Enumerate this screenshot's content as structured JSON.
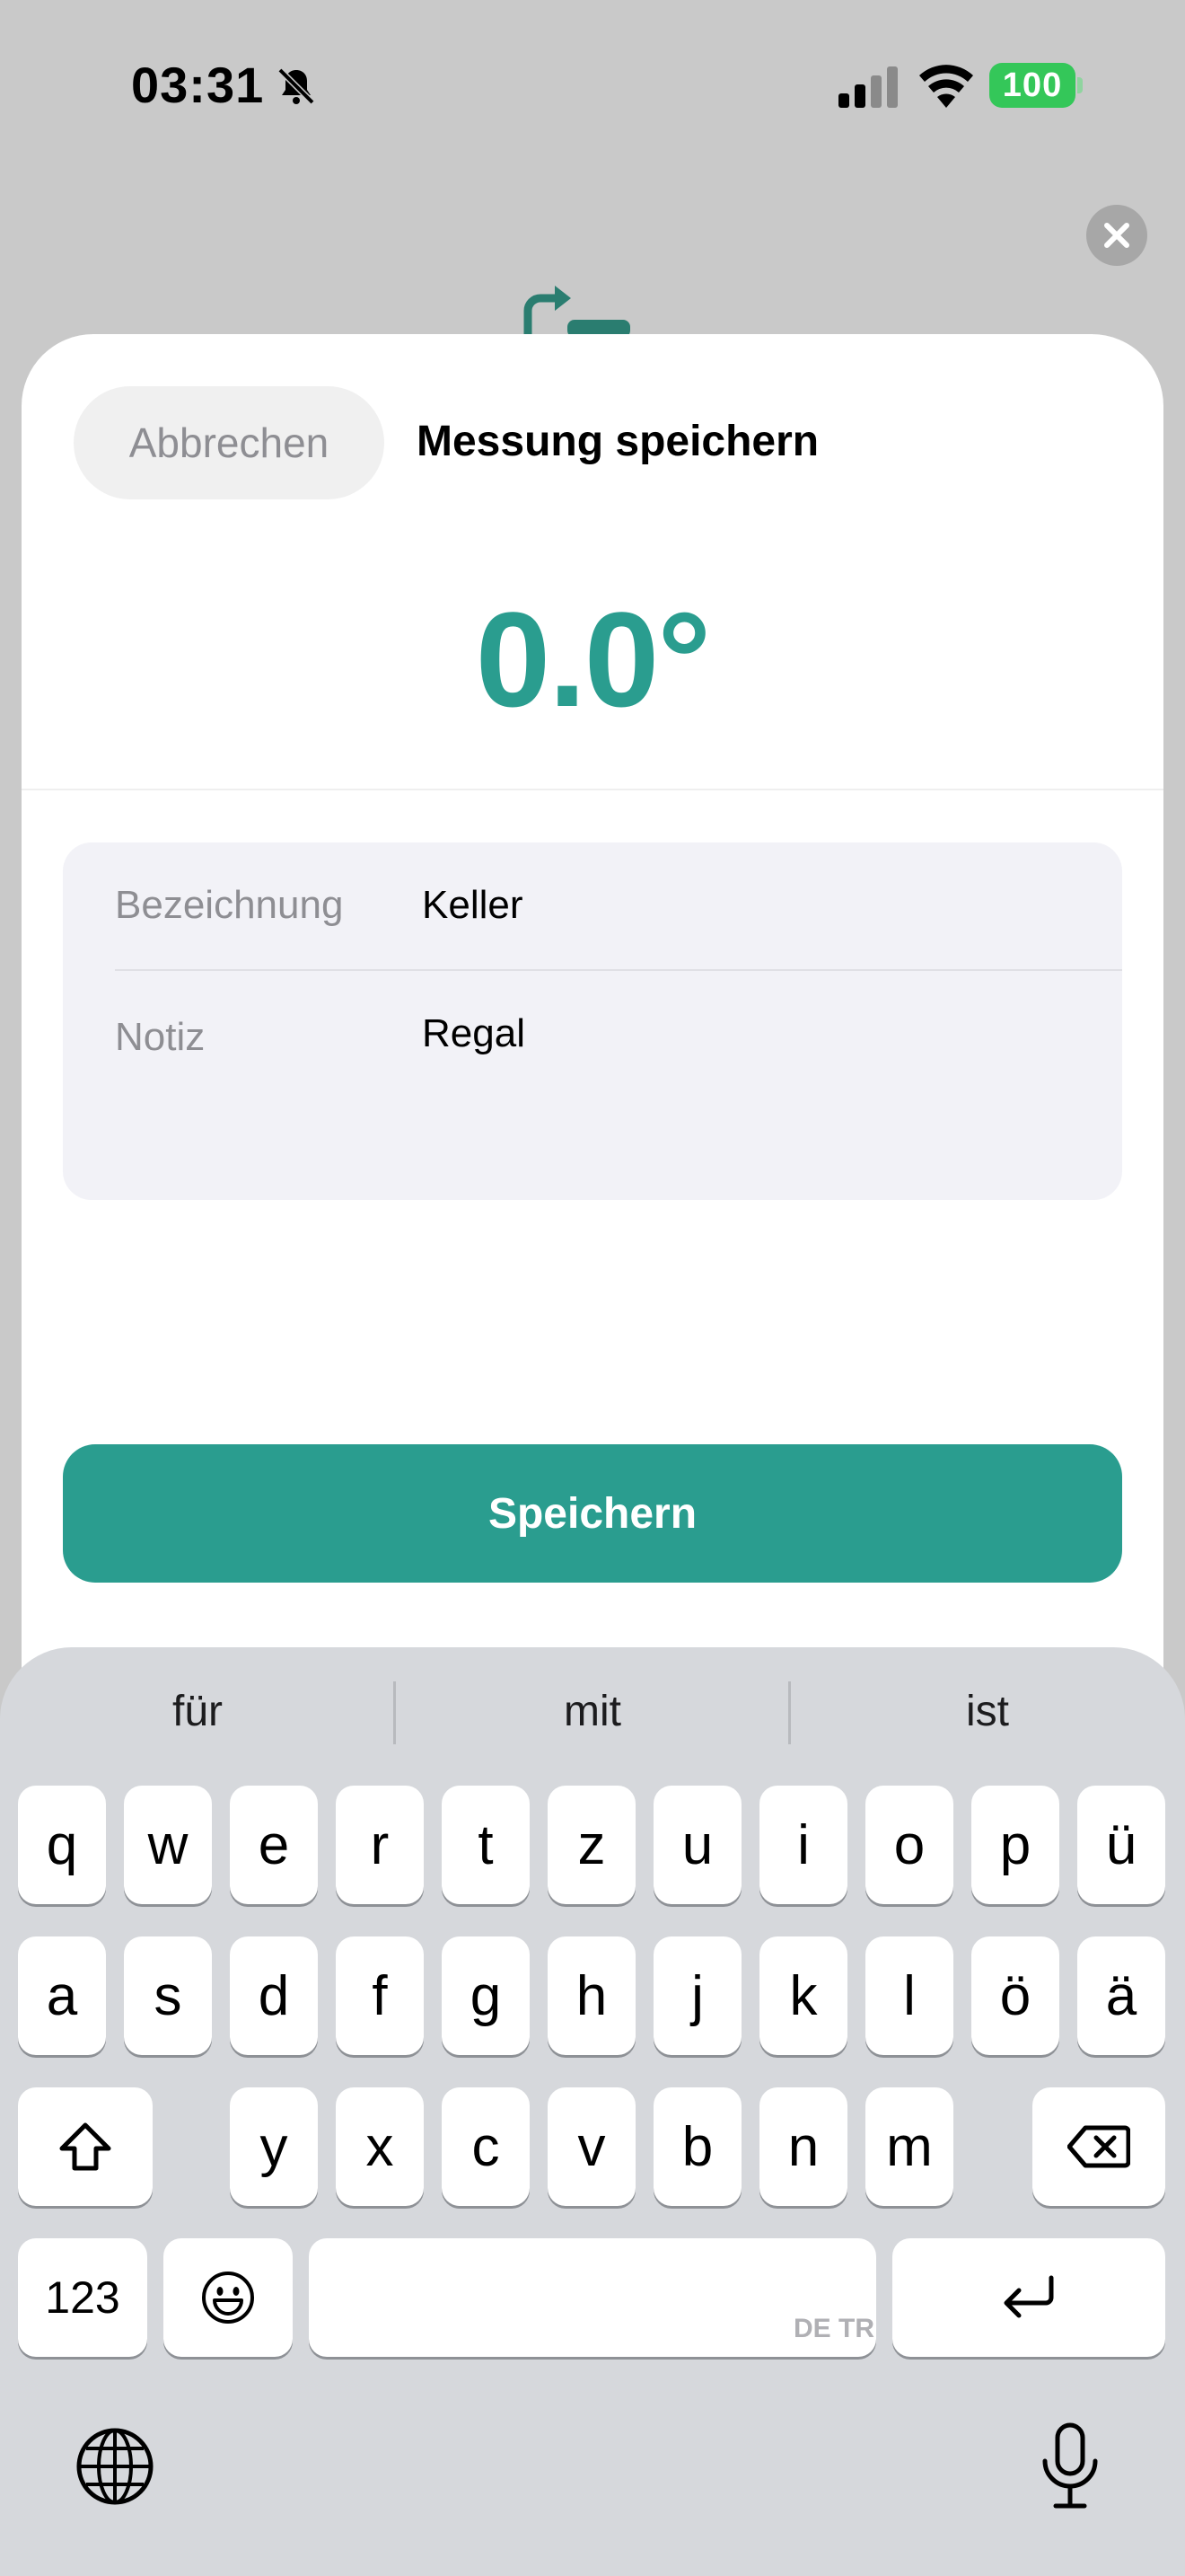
{
  "status_bar": {
    "time": "03:31",
    "battery": "100",
    "icons": [
      "bell-slash-icon",
      "cellular-signal-icon",
      "wifi-icon",
      "battery-icon"
    ]
  },
  "sheet": {
    "cancel_label": "Abbrechen",
    "title": "Messung speichern",
    "angle_value": "0.0°",
    "accent_color": "#2a9d8f"
  },
  "form": {
    "name_label": "Bezeichnung",
    "name_value": "Keller",
    "note_label": "Notiz",
    "note_value": "Regal"
  },
  "save_label": "Speichern",
  "keyboard": {
    "suggestions": [
      "für",
      "mit",
      "ist"
    ],
    "row1": [
      "q",
      "w",
      "e",
      "r",
      "t",
      "z",
      "u",
      "i",
      "o",
      "p",
      "ü"
    ],
    "row2": [
      "a",
      "s",
      "d",
      "f",
      "g",
      "h",
      "j",
      "k",
      "l",
      "ö",
      "ä"
    ],
    "row3": [
      "y",
      "x",
      "c",
      "v",
      "b",
      "n",
      "m"
    ],
    "numbers_label": "123",
    "space_languages": "DE TR"
  }
}
